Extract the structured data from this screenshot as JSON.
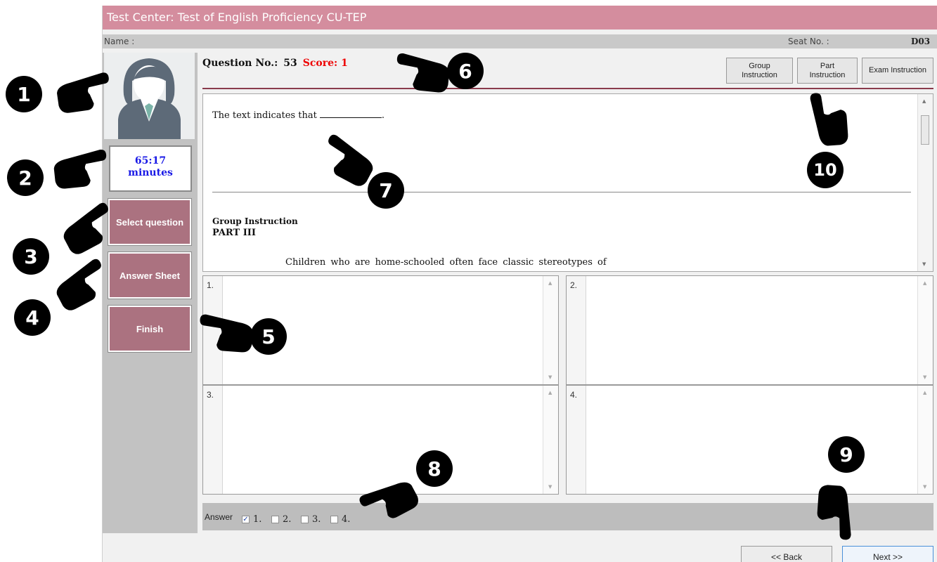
{
  "window": {
    "title": "Test Center: Test of English Proficiency CU-TEP"
  },
  "infobar": {
    "name_label": "Name :",
    "seat_label": "Seat No. :",
    "seat_value": "D03"
  },
  "sidebar": {
    "timer_value": "65:17",
    "timer_unit": "minutes",
    "buttons": [
      "Select question",
      "Answer Sheet",
      "Finish"
    ]
  },
  "question": {
    "label": "Question No.:",
    "number": "53",
    "score": "Score: 1",
    "text": "The text indicates that",
    "text_end": ".",
    "group_instruction": "Group Instruction",
    "part": "PART III",
    "passage": "Children who are home-schooled often face classic stereotypes of"
  },
  "instruction_buttons": {
    "group": "Group Instruction",
    "part": "Part Instruction",
    "exam": "Exam Instruction"
  },
  "choices": [
    "1.",
    "2.",
    "3.",
    "4."
  ],
  "answer": {
    "label": "Answer",
    "options": [
      "1.",
      "2.",
      "3.",
      "4."
    ],
    "checked": "1."
  },
  "footer": {
    "back": "<< Back",
    "next": "Next >>"
  },
  "markers": [
    "1",
    "2",
    "3",
    "4",
    "5",
    "6",
    "7",
    "8",
    "9",
    "10"
  ],
  "colors": {
    "title_bar": "#d48d9e",
    "nav_button": "#ab7280",
    "timer_text": "#1919e6",
    "score_text": "#e00000",
    "header_rule": "#8a3b4c"
  }
}
